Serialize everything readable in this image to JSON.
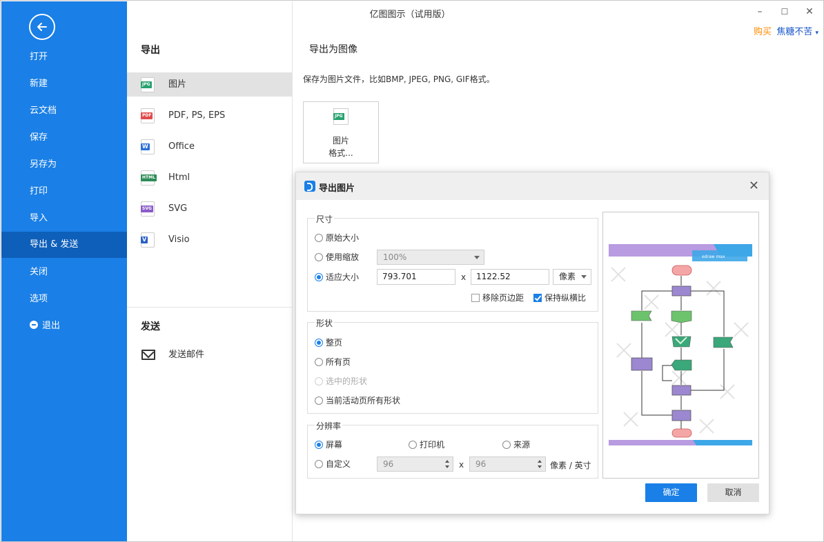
{
  "window": {
    "title": "亿图图示（试用版）",
    "buy_label": "购买",
    "user_label": "焦糖不苦",
    "minimize": "–",
    "maximize": "☐",
    "close": "✕"
  },
  "sidebar": {
    "items": [
      {
        "label": "打开"
      },
      {
        "label": "新建"
      },
      {
        "label": "云文档"
      },
      {
        "label": "保存"
      },
      {
        "label": "另存为"
      },
      {
        "label": "打印"
      },
      {
        "label": "导入"
      },
      {
        "label": "导出 & 发送"
      },
      {
        "label": "关闭"
      },
      {
        "label": "选项"
      },
      {
        "label": "退出"
      }
    ],
    "active_index": 7,
    "bg_color": "#1a7fe6"
  },
  "export_panel": {
    "title": "导出",
    "formats": [
      {
        "label": "图片",
        "badge": "JPG",
        "color": "#27a26e"
      },
      {
        "label": "PDF, PS, EPS",
        "badge": "PDF",
        "color": "#e14b4b"
      },
      {
        "label": "Office",
        "badge": "W",
        "color": "#2b6fd6"
      },
      {
        "label": "Html",
        "badge": "HTML",
        "color": "#2e8b57"
      },
      {
        "label": "SVG",
        "badge": "SVG",
        "color": "#8a5bc9"
      },
      {
        "label": "Visio",
        "badge": "V",
        "color": "#2b5fc4"
      }
    ],
    "send_title": "发送",
    "send_mail": "发送邮件"
  },
  "right": {
    "title": "导出为图像",
    "description": "保存为图片文件，比如BMP, JPEG, PNG, GIF格式。",
    "tile_badge": "JPG",
    "tile_line1": "图片",
    "tile_line2": "格式..."
  },
  "dialog": {
    "title": "导出图片",
    "size_group": "尺寸",
    "size_original": "原始大小",
    "size_zoom": "使用缩放",
    "zoom_value": "100%",
    "size_fit": "适应大小",
    "width": "793.701",
    "x": "x",
    "height": "1122.52",
    "unit": "像素",
    "remove_margin": "移除页边距",
    "keep_ratio": "保持纵横比",
    "shape_group": "形状",
    "shape_whole": "整页",
    "shape_all": "所有页",
    "shape_selected": "选中的形状",
    "shape_current": "当前活动页所有形状",
    "res_group": "分辨率",
    "res_screen": "屏幕",
    "res_printer": "打印机",
    "res_source": "来源",
    "res_custom": "自定义",
    "dpi_x": "96",
    "dpi_y": "96",
    "dpi_unit": "像素 / 英寸",
    "ok": "确定",
    "cancel": "取消",
    "preview_watermark": "edraw max"
  }
}
